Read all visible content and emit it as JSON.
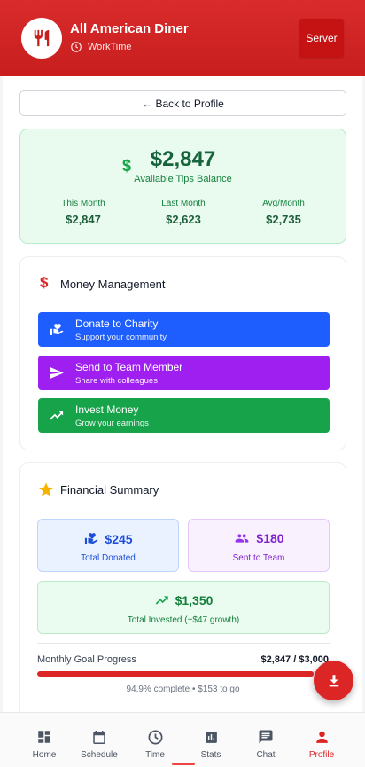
{
  "header": {
    "app_name": "All American Diner",
    "subtitle": "WorkTime",
    "role_button": "Server"
  },
  "back_button": "← Back to Profile",
  "tips": {
    "amount": "$2,847",
    "label": "Available Tips Balance",
    "stats": [
      {
        "label": "This Month",
        "value": "$2,847"
      },
      {
        "label": "Last Month",
        "value": "$2,623"
      },
      {
        "label": "Avg/Month",
        "value": "$2,735"
      }
    ]
  },
  "money_management": {
    "title": "Money Management",
    "actions": [
      {
        "title": "Donate to Charity",
        "subtitle": "Support your community",
        "color": "#1e5eff",
        "icon": "hand-heart-icon"
      },
      {
        "title": "Send to Team Member",
        "subtitle": "Share with colleagues",
        "color": "#9f1ff0",
        "icon": "send-icon"
      },
      {
        "title": "Invest Money",
        "subtitle": "Grow your earnings",
        "color": "#16a34a",
        "icon": "trending-up-icon"
      }
    ]
  },
  "financial_summary": {
    "title": "Financial Summary",
    "donated": {
      "value": "$245",
      "label": "Total Donated"
    },
    "sent": {
      "value": "$180",
      "label": "Sent to Team"
    },
    "invested": {
      "value": "$1,350",
      "label": "Total Invested (+$47 growth)"
    },
    "goal": {
      "label": "Monthly Goal Progress",
      "value": "$2,847 / $3,000",
      "percent": 94.9,
      "note": "94.9% complete • $153 to go"
    }
  },
  "nav": {
    "items": [
      {
        "label": "Home",
        "icon": "dashboard-icon"
      },
      {
        "label": "Schedule",
        "icon": "calendar-icon"
      },
      {
        "label": "Time",
        "icon": "clock-icon"
      },
      {
        "label": "Stats",
        "icon": "bar-chart-icon"
      },
      {
        "label": "Chat",
        "icon": "chat-icon"
      },
      {
        "label": "Profile",
        "icon": "person-icon",
        "active": true
      }
    ]
  },
  "colors": {
    "brand": "#d92b2b",
    "accent_green": "#16a34a",
    "accent_blue": "#1e5eff",
    "accent_purple": "#9f1ff0"
  }
}
